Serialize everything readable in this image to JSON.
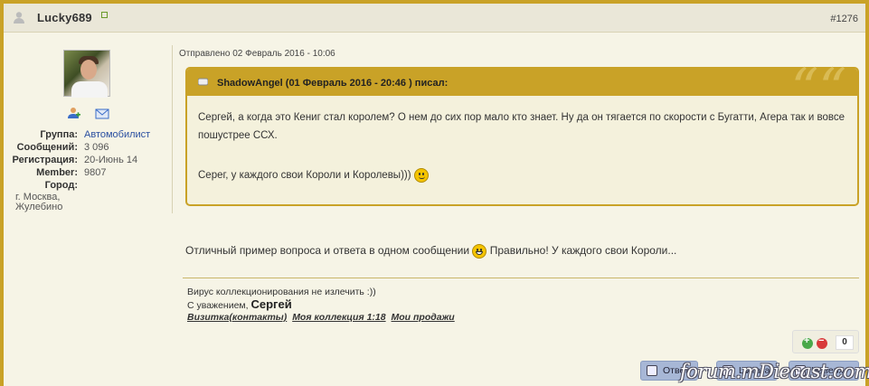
{
  "header": {
    "username": "Lucky689",
    "post_number": "#1276"
  },
  "sidebar": {
    "fields": [
      {
        "label": "Группа:",
        "value": "Автомобилист"
      },
      {
        "label": "Сообщений:",
        "value": "3 096"
      },
      {
        "label": "Регистрация:",
        "value": "20-Июнь 14"
      },
      {
        "label": "Member:",
        "value": "9807"
      },
      {
        "label": "Город:",
        "value": ""
      }
    ],
    "city": "г. Москва, Жулебино"
  },
  "post": {
    "sent": "Отправлено 02 Февраль 2016 - 10:06",
    "quote": {
      "author": "ShadowAngel (01 Февраль 2016 - 20:46 ) писал:",
      "mark": "““",
      "text1": "Сергей, а когда это Кениг стал королем? О нем до сих пор мало кто знает. Ну да он тягается по скорости с Бугатти, Агера так и вовсе пошустрее ССХ.",
      "text2": "Серег, у каждого свои Короли и Королевы)))"
    },
    "message_a": "Отличный пример вопроса и ответа в одном сообщении",
    "message_b": "Правильно! У каждого свои Короли..."
  },
  "signature": {
    "line1": "Вирус коллекционирования не излечить :))",
    "greeting": "С уважением,",
    "name": "Сергей",
    "links": [
      "Визитка(контакты)",
      "Моя коллекция 1:18",
      "Мои продажи"
    ]
  },
  "reputation": {
    "count": "0"
  },
  "buttons": {
    "reply": "Ответ",
    "quote": "Цитата",
    "top": "Наверх"
  },
  "watermark": "forum.mDiecast.com"
}
